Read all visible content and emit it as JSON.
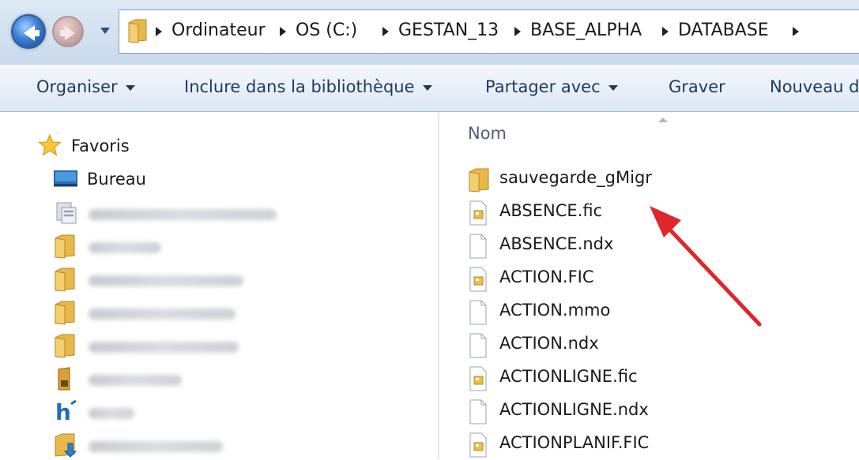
{
  "address": {
    "crumbs": [
      "Ordinateur",
      "OS (C:)",
      "GESTAN_13",
      "BASE_ALPHA",
      "DATABASE"
    ]
  },
  "toolbar": {
    "organize": "Organiser",
    "include_library": "Inclure dans la bibliothèque",
    "share_with": "Partager avec",
    "burn": "Graver",
    "new_folder": "Nouveau d"
  },
  "nav": {
    "favorites": "Favoris",
    "desktop": "Bureau",
    "blurred_items": [
      {
        "icon": "recent-places-icon"
      },
      {
        "icon": "folder-icon"
      },
      {
        "icon": "folder-icon"
      },
      {
        "icon": "folder-icon"
      },
      {
        "icon": "folder-icon"
      },
      {
        "icon": "app-icon"
      },
      {
        "icon": "h-app-icon"
      },
      {
        "icon": "downloads-folder-icon"
      }
    ]
  },
  "files": {
    "column_name": "Nom",
    "items": [
      {
        "name": "sauvegarde_gMigr",
        "icon": "folder-icon"
      },
      {
        "name": "ABSENCE.fic",
        "icon": "fic-file-icon"
      },
      {
        "name": "ABSENCE.ndx",
        "icon": "blank-file-icon"
      },
      {
        "name": "ACTION.FIC",
        "icon": "fic-file-icon"
      },
      {
        "name": "ACTION.mmo",
        "icon": "blank-file-icon"
      },
      {
        "name": "ACTION.ndx",
        "icon": "blank-file-icon"
      },
      {
        "name": "ACTIONLIGNE.fic",
        "icon": "fic-file-icon"
      },
      {
        "name": "ACTIONLIGNE.ndx",
        "icon": "blank-file-icon"
      },
      {
        "name": "ACTIONPLANIF.FIC",
        "icon": "fic-file-icon"
      }
    ]
  },
  "colors": {
    "annotation_arrow": "#e0262a",
    "folder": "#e8b84a",
    "toolbar_text": "#1e395b"
  }
}
